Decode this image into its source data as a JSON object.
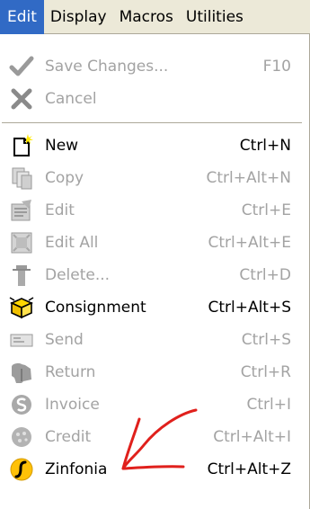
{
  "menubar": {
    "items": [
      {
        "label": "Edit",
        "active": true
      },
      {
        "label": "Display"
      },
      {
        "label": "Macros"
      },
      {
        "label": "Utilities"
      }
    ]
  },
  "menu": {
    "save_changes": {
      "label": "Save Changes...",
      "shortcut": "F10",
      "enabled": false,
      "icon": "checkmark-icon"
    },
    "cancel": {
      "label": "Cancel",
      "shortcut": "",
      "enabled": false,
      "icon": "x-icon"
    },
    "new": {
      "label": "New",
      "shortcut": "Ctrl+N",
      "enabled": true,
      "icon": "new-document-icon"
    },
    "copy": {
      "label": "Copy",
      "shortcut": "Ctrl+Alt+N",
      "enabled": false,
      "icon": "copy-icon"
    },
    "edit": {
      "label": "Edit",
      "shortcut": "Ctrl+E",
      "enabled": false,
      "icon": "edit-icon"
    },
    "edit_all": {
      "label": "Edit All",
      "shortcut": "Ctrl+Alt+E",
      "enabled": false,
      "icon": "edit-all-icon"
    },
    "delete": {
      "label": "Delete...",
      "shortcut": "Ctrl+D",
      "enabled": false,
      "icon": "delete-icon"
    },
    "consignment": {
      "label": "Consignment",
      "shortcut": "Ctrl+Alt+S",
      "enabled": true,
      "icon": "consignment-box-icon"
    },
    "send": {
      "label": "Send",
      "shortcut": "Ctrl+S",
      "enabled": false,
      "icon": "send-icon"
    },
    "return": {
      "label": "Return",
      "shortcut": "Ctrl+R",
      "enabled": false,
      "icon": "return-icon"
    },
    "invoice": {
      "label": "Invoice",
      "shortcut": "Ctrl+I",
      "enabled": false,
      "icon": "invoice-icon"
    },
    "credit": {
      "label": "Credit",
      "shortcut": "Ctrl+Alt+I",
      "enabled": false,
      "icon": "credit-icon"
    },
    "zinfonia": {
      "label": "Zinfonia",
      "shortcut": "Ctrl+Alt+Z",
      "enabled": true,
      "icon": "zinfonia-icon"
    }
  },
  "colors": {
    "menu_highlight": "#316ac5",
    "disabled_text": "#a3a3a3",
    "annotation_arrow": "#e0201c"
  }
}
